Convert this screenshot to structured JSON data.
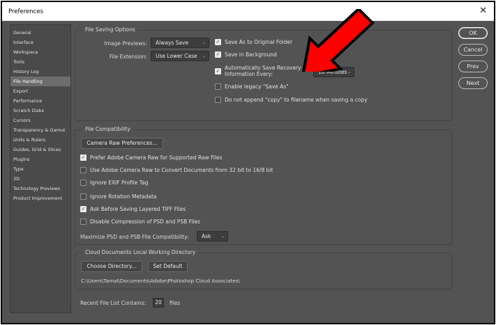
{
  "window": {
    "title": "Preferences",
    "close_glyph": "✕"
  },
  "sidebar": {
    "items": [
      {
        "label": "General"
      },
      {
        "label": "Interface"
      },
      {
        "label": "Workspace"
      },
      {
        "label": "Tools"
      },
      {
        "label": "History Log"
      },
      {
        "label": "File Handling",
        "active": true
      },
      {
        "label": "Export"
      },
      {
        "label": "Performance"
      },
      {
        "label": "Scratch Disks"
      },
      {
        "label": "Cursors"
      },
      {
        "label": "Transparency & Gamut"
      },
      {
        "label": "Units & Rulers"
      },
      {
        "label": "Guides, Grid & Slices"
      },
      {
        "label": "Plugins"
      },
      {
        "label": "Type"
      },
      {
        "label": "3D"
      },
      {
        "label": "Technology Previews"
      },
      {
        "label": "Product Improvement"
      }
    ]
  },
  "file_saving": {
    "legend": "File Saving Options",
    "image_previews_label": "Image Previews:",
    "image_previews_value": "Always Save",
    "file_extension_label": "File Extension:",
    "file_extension_value": "Use Lower Case",
    "save_original_folder": {
      "label": "Save As to Original Folder",
      "checked": true
    },
    "save_background": {
      "label": "Save in Background",
      "checked": true
    },
    "auto_save": {
      "label_line1": "Automatically Save Recovery",
      "label_line2": "Information Every:",
      "checked": true
    },
    "auto_save_interval": "10 Minutes",
    "legacy_save_as": {
      "label": "Enable legacy \"Save As\"",
      "checked": false
    },
    "no_copy": {
      "label": "Do not append \"copy\" to filename when saving a copy",
      "checked": false
    }
  },
  "file_compat": {
    "legend": "File Compatibility",
    "camera_raw_button": "Camera Raw Preferences...",
    "options": [
      {
        "label": "Prefer Adobe Camera Raw for Supported Raw Files",
        "checked": true
      },
      {
        "label": "Use Adobe Camera Raw to Convert Documents from 32 bit to 16/8 bit",
        "checked": false
      },
      {
        "label": "Ignore EXIF Profile Tag",
        "checked": false
      },
      {
        "label": "Ignore Rotation Metadata",
        "checked": false
      },
      {
        "label": "Ask Before Saving Layered TIFF Files",
        "checked": true
      },
      {
        "label": "Disable Compression of PSD and PSB Files",
        "checked": false
      }
    ],
    "maximize_label": "Maximize PSD and PSB File Compatibility:",
    "maximize_value": "Ask"
  },
  "cloud": {
    "legend": "Cloud Documents Local Working Directory",
    "choose_button": "Choose Directory...",
    "default_button": "Set Default",
    "path": "C:\\Users\\Tamal\\Documents\\Adobe\\Photoshop Cloud Associates\\"
  },
  "recent": {
    "label": "Recent File List Contains:",
    "value": "20",
    "suffix": "files"
  },
  "buttons": {
    "ok": "OK",
    "cancel": "Cancel",
    "prev": "Prev",
    "next": "Next"
  },
  "colors": {
    "dialog_bg": "#535353",
    "annotation_arrow": "#ff0000"
  },
  "glyphs": {
    "check": "✓",
    "chevron": "⌄"
  }
}
